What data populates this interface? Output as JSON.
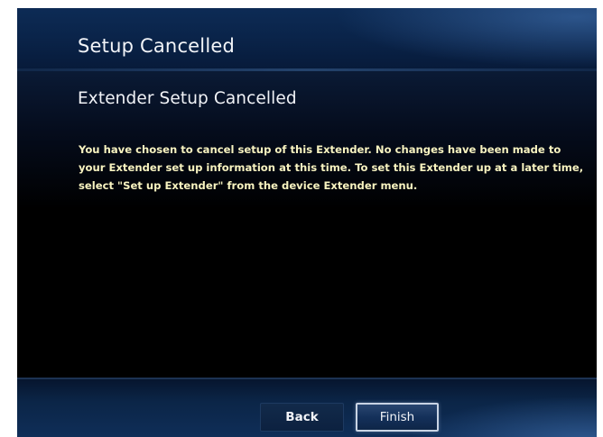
{
  "header": {
    "title": "Setup Cancelled"
  },
  "main": {
    "section_title": "Extender Setup Cancelled",
    "message": "You have chosen to cancel setup of this Extender. No changes have been made to your Extender set up information at this time. To set this Extender up at a later time, select \"Set up Extender\" from the device Extender menu."
  },
  "footer": {
    "back_label": "Back",
    "finish_label": "Finish"
  },
  "colors": {
    "header_blue": "#0a244a",
    "body_text": "#f8f3c0",
    "title_text": "#f2f4f8",
    "focus_border": "#c9d4e4"
  }
}
